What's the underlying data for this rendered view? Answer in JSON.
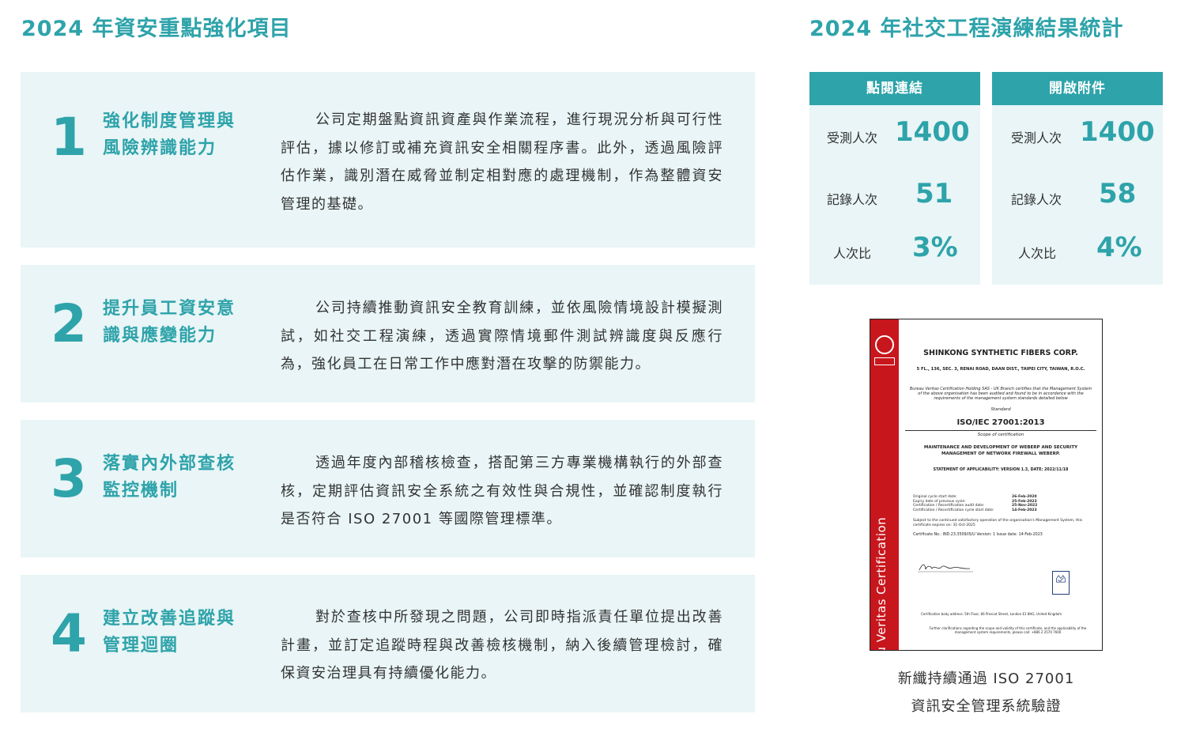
{
  "left_title": "2024 年資安重點強化項目",
  "right_title": "2024 年社交工程演練結果統計",
  "items": [
    {
      "num": "1",
      "heading_l1": "強化制度管理與",
      "heading_l2": "風險辨識能力",
      "body": "公司定期盤點資訊資產與作業流程，進行現況分析與可行性評估，據以修訂或補充資訊安全相關程序書。此外，透過風險評估作業，識別潛在威脅並制定相對應的處理機制，作為整體資安管理的基礎。"
    },
    {
      "num": "2",
      "heading_l1": "提升員工資安意",
      "heading_l2": "識與應變能力",
      "body": "公司持續推動資訊安全教育訓練，並依風險情境設計模擬測試，如社交工程演練，透過實際情境郵件測試辨識度與反應行為，強化員工在日常工作中應對潛在攻擊的防禦能力。"
    },
    {
      "num": "3",
      "heading_l1": "落實內外部查核",
      "heading_l2": "監控機制",
      "body": "透過年度內部稽核檢查，搭配第三方專業機構執行的外部查核，定期評估資訊安全系統之有效性與合規性，並確認制度執行是否符合 ISO 27001 等國際管理標準。"
    },
    {
      "num": "4",
      "heading_l1": "建立改善追蹤與",
      "heading_l2": "管理迴圈",
      "body": "對於查核中所發現之問題，公司即時指派責任單位提出改善計畫，並訂定追蹤時程與改善檢核機制，納入後續管理檢討，確保資安治理具有持續優化能力。"
    }
  ],
  "stats": [
    {
      "header": "點閱連結",
      "rows": [
        {
          "label": "受測人次",
          "value": "1400"
        },
        {
          "label": "記錄人次",
          "value": "51"
        },
        {
          "label": "人次比",
          "value": "3%"
        }
      ]
    },
    {
      "header": "開啟附件",
      "rows": [
        {
          "label": "受測人次",
          "value": "1400"
        },
        {
          "label": "記錄人次",
          "value": "58"
        },
        {
          "label": "人次比",
          "value": "4%"
        }
      ]
    }
  ],
  "certificate": {
    "band_text": "Bureau Veritas Certification",
    "company": "SHINKONG SYNTHETIC FIBERS CORP.",
    "address": "5 FL., 136, SEC. 3, RENAI ROAD, DAAN DIST., TAIPEI CITY, TAIWAN, R.O.C.",
    "statement": "Bureau Veritas Certification Holding SAS - UK Branch certifies that the Management System of the above organisation has been audited and found to be in accordance with the requirements of the management system standards detailed below",
    "standard_label": "Standard",
    "standard": "ISO/IEC 27001:2013",
    "scope_label": "Scope of certification",
    "scope": "MAINTENANCE AND DEVELOPMENT OF WEBERP AND SECURITY MANAGEMENT OF NETWORK FIREWALL WEBERP.",
    "soa": "STATEMENT OF APPLICABILITY: VERSION 1.3, DATE: 2022/11/18",
    "dates": [
      {
        "label": "Original cycle start date:",
        "value": "26-Feb-2020"
      },
      {
        "label": "Expiry date of previous cycle:",
        "value": "25-Feb-2023"
      },
      {
        "label": "Certification / Recertification audit date:",
        "value": "25-Nov-2022"
      },
      {
        "label": "Certification / Recertification cycle start date:",
        "value": "14-Feb-2023"
      }
    ],
    "subject": "Subject to the continued satisfactory operation of the organisation's Management System, this certificate expires on: 31-Oct-2025",
    "cert_no": "Certificate No.: IND.23.3509/IS/U        Version: 1        Issue date: 14-Feb-2023",
    "signature": "Andrew Lee",
    "ukas": "UKAS",
    "footer": "Certification body address: 5th Floor, 66 Prescot Street, London E1 8HG, United Kingdom",
    "footer2": "Further clarifications regarding the scope and validity of this certificate, and the applicability of the management system requirements, please call: +886 2 2570 7600"
  },
  "caption_l1": "新纖持續通過 ISO 27001",
  "caption_l2": "資訊安全管理系統驗證"
}
